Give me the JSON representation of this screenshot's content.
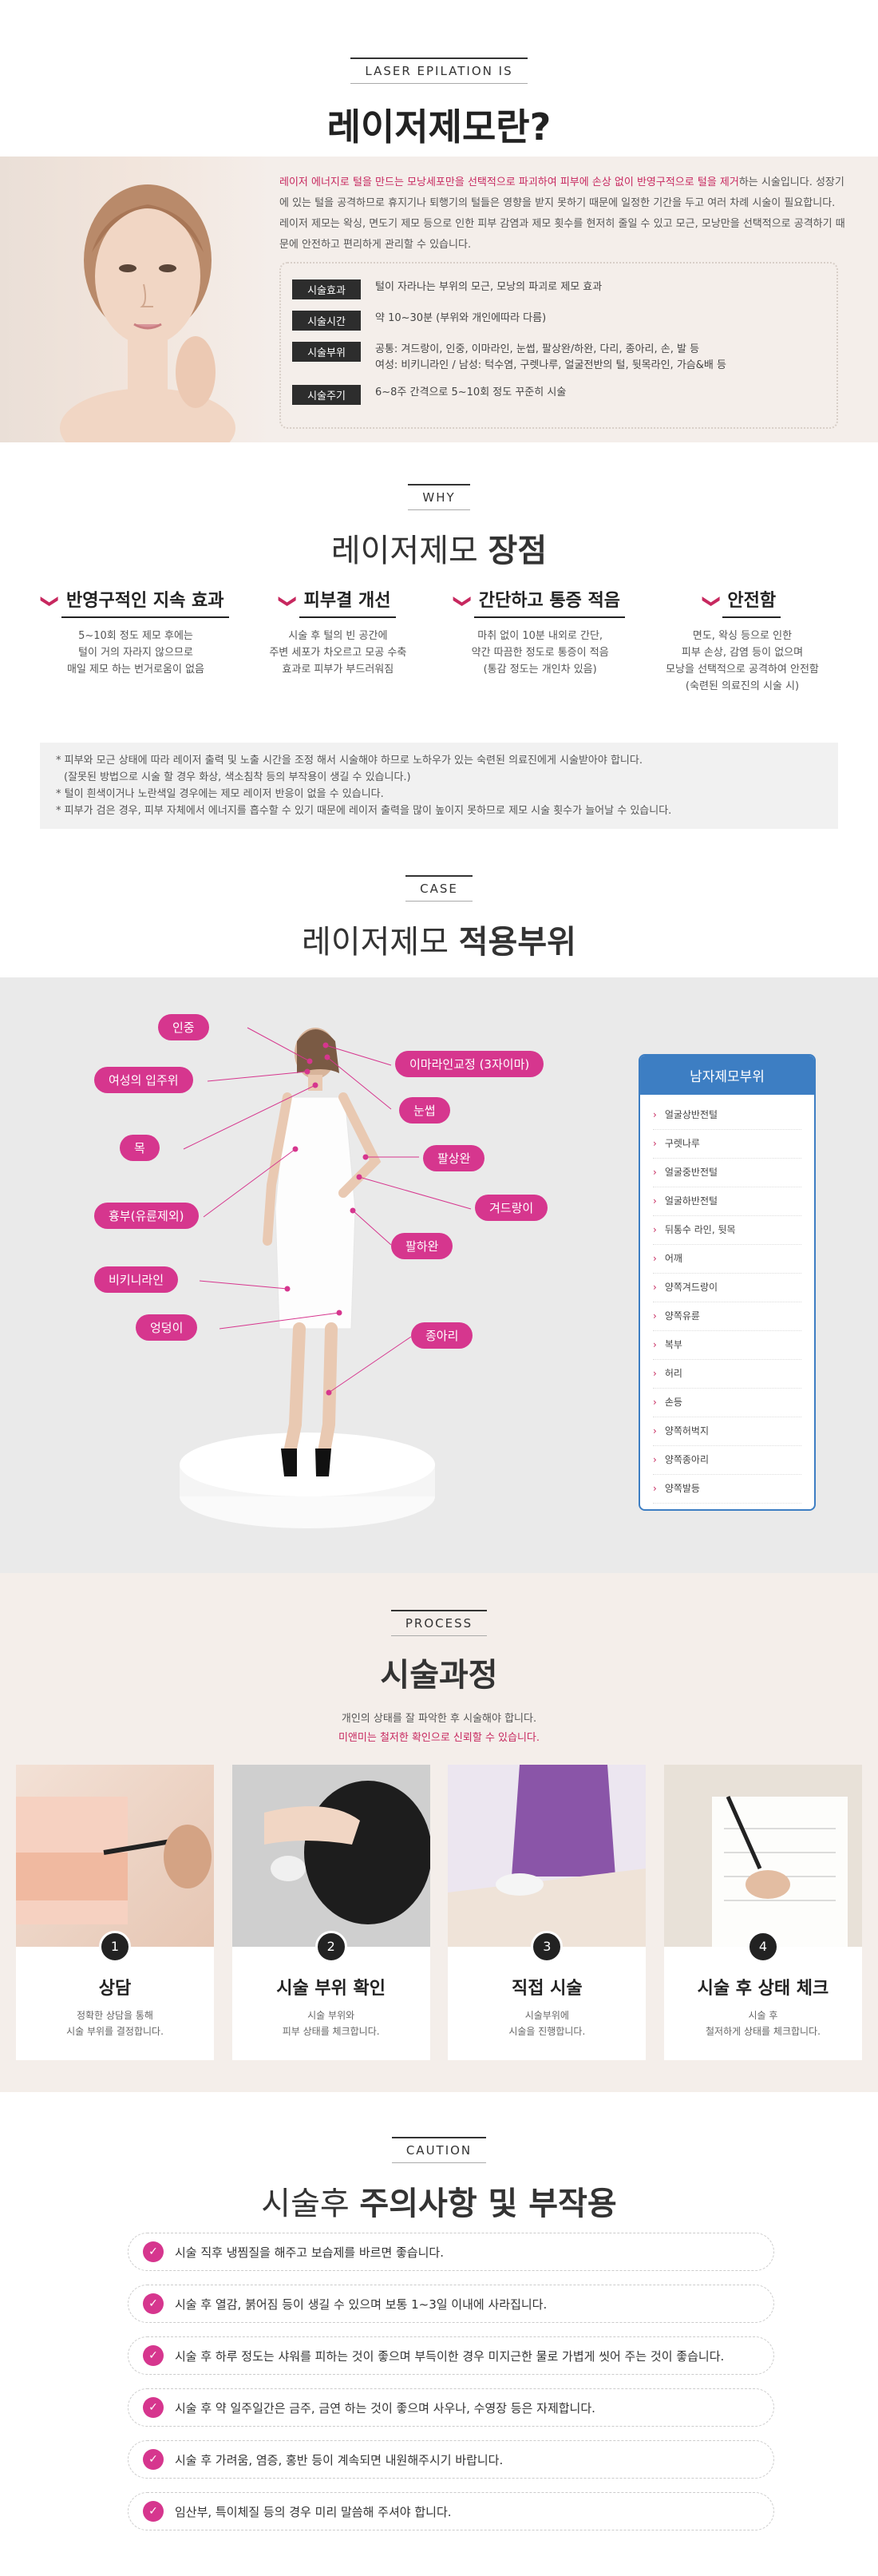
{
  "intro": {
    "tag": "LASER EPILATION IS",
    "title": "레이저제모란?",
    "para_highlight": "레이저 에너지로 털을 만드는 모낭세포만을 선택적으로 파괴하여 피부에 손상 없이 반영구적으로 털을 제거",
    "para_rest": "하는 시술입니다. 성장기에 있는 털을 공격하므로 휴지기나 퇴행기의 털들은 영향을 받지 못하기 때문에 일정한 기간을 두고 여러 차례 시술이 필요합니다. 레이저 제모는 왁싱, 면도기 제모 등으로 인한 피부 감염과 제모 횟수를 현저히 줄일 수 있고 모근, 모낭만을 선택적으로 공격하기 때문에 안전하고 편리하게 관리할 수 있습니다.",
    "rows": [
      {
        "label": "시술효과",
        "value": "털이 자라나는 부위의 모근, 모낭의 파괴로 제모 효과"
      },
      {
        "label": "시술시간",
        "value": "약 10~30분 (부위와 개인에따라 다름)"
      },
      {
        "label": "시술부위",
        "value": "공통: 겨드랑이, 인중, 이마라인, 눈썹, 팔상완/하완, 다리, 종아리, 손, 발 등",
        "value2": "여성: 비키니라인 / 남성: 턱수염, 구렛나루, 얼굴전반의 털, 뒷목라인, 가슴&배 등"
      },
      {
        "label": "시술주기",
        "value": "6~8주 간격으로 5~10회 정도 꾸준히 시술"
      }
    ]
  },
  "why": {
    "tag": "WHY",
    "title_light": "레이저제모",
    "title_bold": "장점",
    "items": [
      {
        "title": "반영구적인 지속 효과",
        "lines": [
          "5~10회 정도 제모 후에는",
          "털이 거의 자라지 않으므로",
          "매일 제모 하는 번거로움이 없음"
        ]
      },
      {
        "title": "피부결 개선",
        "lines": [
          "시술 후 털의 빈 공간에",
          "주변 세포가 차오르고 모공 수축",
          "효과로 피부가 부드러워짐"
        ]
      },
      {
        "title": "간단하고 통증 적음",
        "lines": [
          "마취 없이 10분 내외로 간단,",
          "약간 따끔한 정도로 통증이 적음",
          "(통감 정도는 개인차 있음)"
        ]
      },
      {
        "title": "안전함",
        "lines": [
          "면도, 왁싱 등으로 인한",
          "피부 손상, 감염 등이 없으며",
          "모낭을 선택적으로 공격하여 안전함",
          "(숙련된 의료진의 시술 시)"
        ]
      }
    ],
    "notes": [
      "* 피부와 모근 상태에 따라 레이저 출력 및 노출 시간을 조정 해서 시술해야 하므로 노하우가 있는 숙련된 의료진에게 시술받아야 합니다.",
      "  (잘못된 방법으로 시술 할 경우 화상, 색소침착 등의 부작용이 생길 수 있습니다.)",
      "* 털이 흰색이거나 노란색일 경우에는 제모 레이저 반응이 없을 수 있습니다.",
      "* 피부가 검은 경우, 피부 자체에서 에너지를 흡수할 수 있기 때문에 레이저 출력을 많이 높이지 못하므로 제모 시술 횟수가 늘어날 수 있습니다."
    ]
  },
  "case": {
    "tag": "CASE",
    "title_light": "레이저제모",
    "title_bold": "적용부위",
    "pills": [
      "인중",
      "여성의 입주위",
      "목",
      "흉부(유륜제외)",
      "비키니라인",
      "엉덩이",
      "이마라인교정 (3자이마)",
      "눈썹",
      "팔상완",
      "겨드랑이",
      "팔하완",
      "종아리"
    ],
    "men_title": "남자제모부위",
    "men_items": [
      "얼굴상반전털",
      "구렛나루",
      "얼굴중반전털",
      "얼굴하반전털",
      "뒤통수 라인, 뒷목",
      "어깨",
      "양쪽겨드랑이",
      "양쪽유륜",
      "복부",
      "허리",
      "손등",
      "양쪽허벅지",
      "양쪽종아리",
      "양쪽발등"
    ]
  },
  "process": {
    "tag": "PROCESS",
    "title": "시술과정",
    "sub1": "개인의 상태를 잘 파악한 후 시술해야 합니다.",
    "sub2_highlight": "미앤미는 철저한 확인으로 신뢰할 수 있습니다.",
    "steps": [
      {
        "num": "1",
        "title": "상담",
        "lines": [
          "정확한 상담을 통해",
          "시술 부위를 결정합니다."
        ]
      },
      {
        "num": "2",
        "title": "시술 부위 확인",
        "lines": [
          "시술 부위와",
          "피부 상태를 체크합니다."
        ]
      },
      {
        "num": "3",
        "title": "직접 시술",
        "lines": [
          "시술부위에",
          "시술을 진행합니다."
        ]
      },
      {
        "num": "4",
        "title": "시술 후 상태 체크",
        "lines": [
          "시술 후",
          "철저하게 상태를 체크합니다."
        ]
      }
    ]
  },
  "caution": {
    "tag": "CAUTION",
    "title_light": "시술후",
    "title_bold": "주의사항 및 부작용",
    "items": [
      "시술 직후 냉찜질을 해주고 보습제를 바르면 좋습니다.",
      "시술 후 열감, 붉어짐 등이 생길 수 있으며 보통 1~3일 이내에 사라집니다.",
      "시술 후 하루 정도는 샤워를 피하는 것이 좋으며 부득이한 경우 미지근한 물로 가볍게 씻어 주는 것이 좋습니다.",
      "시술 후 약 일주일간은 금주, 금연 하는 것이 좋으며 사우나, 수영장 등은 자제합니다.",
      "시술 후 가려움, 염증, 홍반 등이 계속되면 내원해주시기 바랍니다.",
      "임산부, 특이체질 등의 경우 미리 말씀해 주셔야 합니다."
    ]
  },
  "colors": {
    "accent": "#d6368e",
    "dark": "#2d2d2d",
    "beige": "#f4eeea",
    "blue": "#3d7ec3"
  }
}
